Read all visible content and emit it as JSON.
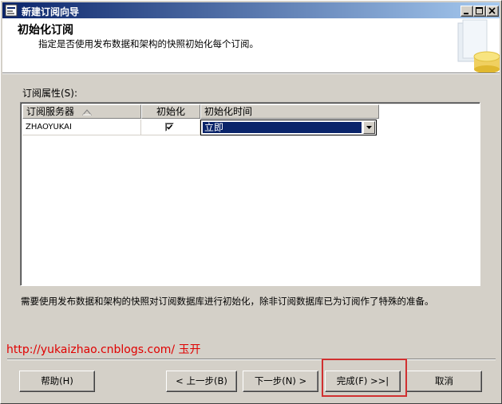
{
  "window": {
    "title": "新建订阅向导"
  },
  "header": {
    "title": "初始化订阅",
    "subtitle": "指定是否使用发布数据和架构的快照初始化每个订阅。"
  },
  "grid": {
    "label": "订阅属性(S):",
    "columns": [
      {
        "label": "订阅服务器",
        "sorted": "ascending"
      },
      {
        "label": "初始化"
      },
      {
        "label": "初始化时间"
      }
    ],
    "rows": [
      {
        "subscriber": "ZHAOYUKAI",
        "initialize": true,
        "init_time": "立即"
      }
    ]
  },
  "footnote": "需要使用发布数据和架构的快照对订阅数据库进行初始化，除非订阅数据库已为订阅作了特殊的准备。",
  "watermark": "http://yukaizhao.cnblogs.com/ 玉开",
  "buttons": {
    "help": "帮助(H)",
    "back": "< 上一步(B)",
    "next": "下一步(N) >",
    "finish": "完成(F) >>|",
    "cancel": "取消"
  },
  "colors": {
    "titlebar_start": "#0a246a",
    "titlebar_end": "#a6caf0",
    "highlight_box": "#d03030",
    "watermark": "#e00000"
  }
}
